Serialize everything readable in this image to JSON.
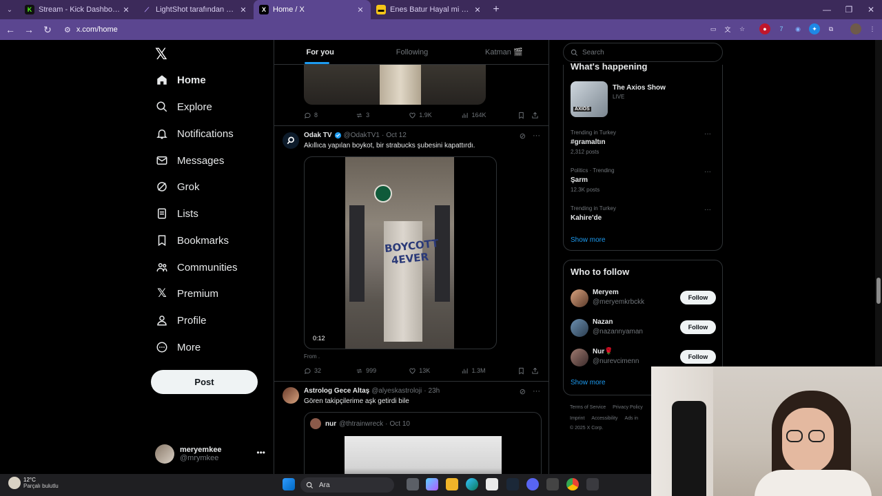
{
  "browser": {
    "tabs": [
      {
        "title": "Stream - Kick Dashboard",
        "fav": "K",
        "fav_color": "#53fc18"
      },
      {
        "title": "LightShot tarafından Ekran Gör",
        "fav": "⟋",
        "fav_color": "#7b4dff"
      },
      {
        "title": "Home / X",
        "fav": "X",
        "fav_color": "#000000"
      },
      {
        "title": "Enes Batur Hayal mi Gerçek Mi",
        "fav": "▬",
        "fav_color": "#f5c518"
      }
    ],
    "url": "x.com/home"
  },
  "nav": {
    "items": [
      "Home",
      "Explore",
      "Notifications",
      "Messages",
      "Grok",
      "Lists",
      "Bookmarks",
      "Communities",
      "Premium",
      "Profile",
      "More"
    ],
    "post_label": "Post",
    "account_name": "meryemkee",
    "account_handle": "@mrymkee"
  },
  "feed": {
    "tabs": [
      "For you",
      "Following",
      "Katman 🎬"
    ],
    "tweet0_actions": {
      "replies": "8",
      "reposts": "3",
      "likes": "1.9K",
      "views": "164K"
    },
    "tweet1": {
      "name": "Odak TV",
      "handle": "@OdakTV1",
      "time": "Oct 12",
      "text": "Akıllıca yapılan boykot, bir strabucks şubesini kapattırdı.",
      "graffiti_1": "BOYCOTT",
      "graffiti_2": "4EVER",
      "duration": "0:12",
      "from": "From .",
      "replies": "32",
      "reposts": "999",
      "likes": "13K",
      "views": "1.3M"
    },
    "tweet2": {
      "name": "Astrolog Gece Altaş",
      "handle": "@alyeskastroloji",
      "time": "23h",
      "text": "Gören takipçilerime aşk getirdi bile",
      "quote_name": "nur",
      "quote_handle": "@thtrainwreck",
      "quote_time": "Oct 10"
    }
  },
  "sidebar": {
    "search_placeholder": "Search",
    "happening_title": "What's happening",
    "axios_title": "The Axios Show",
    "axios_live": "LIVE",
    "axios_thumb": "AXIOS",
    "trends": [
      {
        "context": "Trending in Turkey",
        "topic": "#gramaltın",
        "posts": "2,312 posts"
      },
      {
        "context": "Politics · Trending",
        "topic": "Şarm",
        "posts": "12.3K posts"
      },
      {
        "context": "Trending in Turkey",
        "topic": "Kahire'de",
        "posts": ""
      }
    ],
    "show_more": "Show more",
    "who_title": "Who to follow",
    "who": [
      {
        "name": "Meryem",
        "handle": "@meryemkrbckk",
        "button": "Follow"
      },
      {
        "name": "Nazan",
        "handle": "@nazannyaman",
        "button": "Follow"
      },
      {
        "name": "Nur🌹",
        "handle": "@nurevcimenn",
        "button": "Follow"
      }
    ],
    "footer_row1": [
      "Terms of Service",
      "Privacy Policy"
    ],
    "footer_row2": [
      "Imprint",
      "Accessibility",
      "Ads in"
    ],
    "copyright": "© 2025 X Corp."
  },
  "taskbar": {
    "temp": "12°C",
    "condition": "Parçalı bulutlu",
    "search_label": "Ara"
  },
  "colors": {
    "accent": "#1d9bf0",
    "chrome": "#5b4690",
    "tabbar": "#3c2a5a"
  }
}
